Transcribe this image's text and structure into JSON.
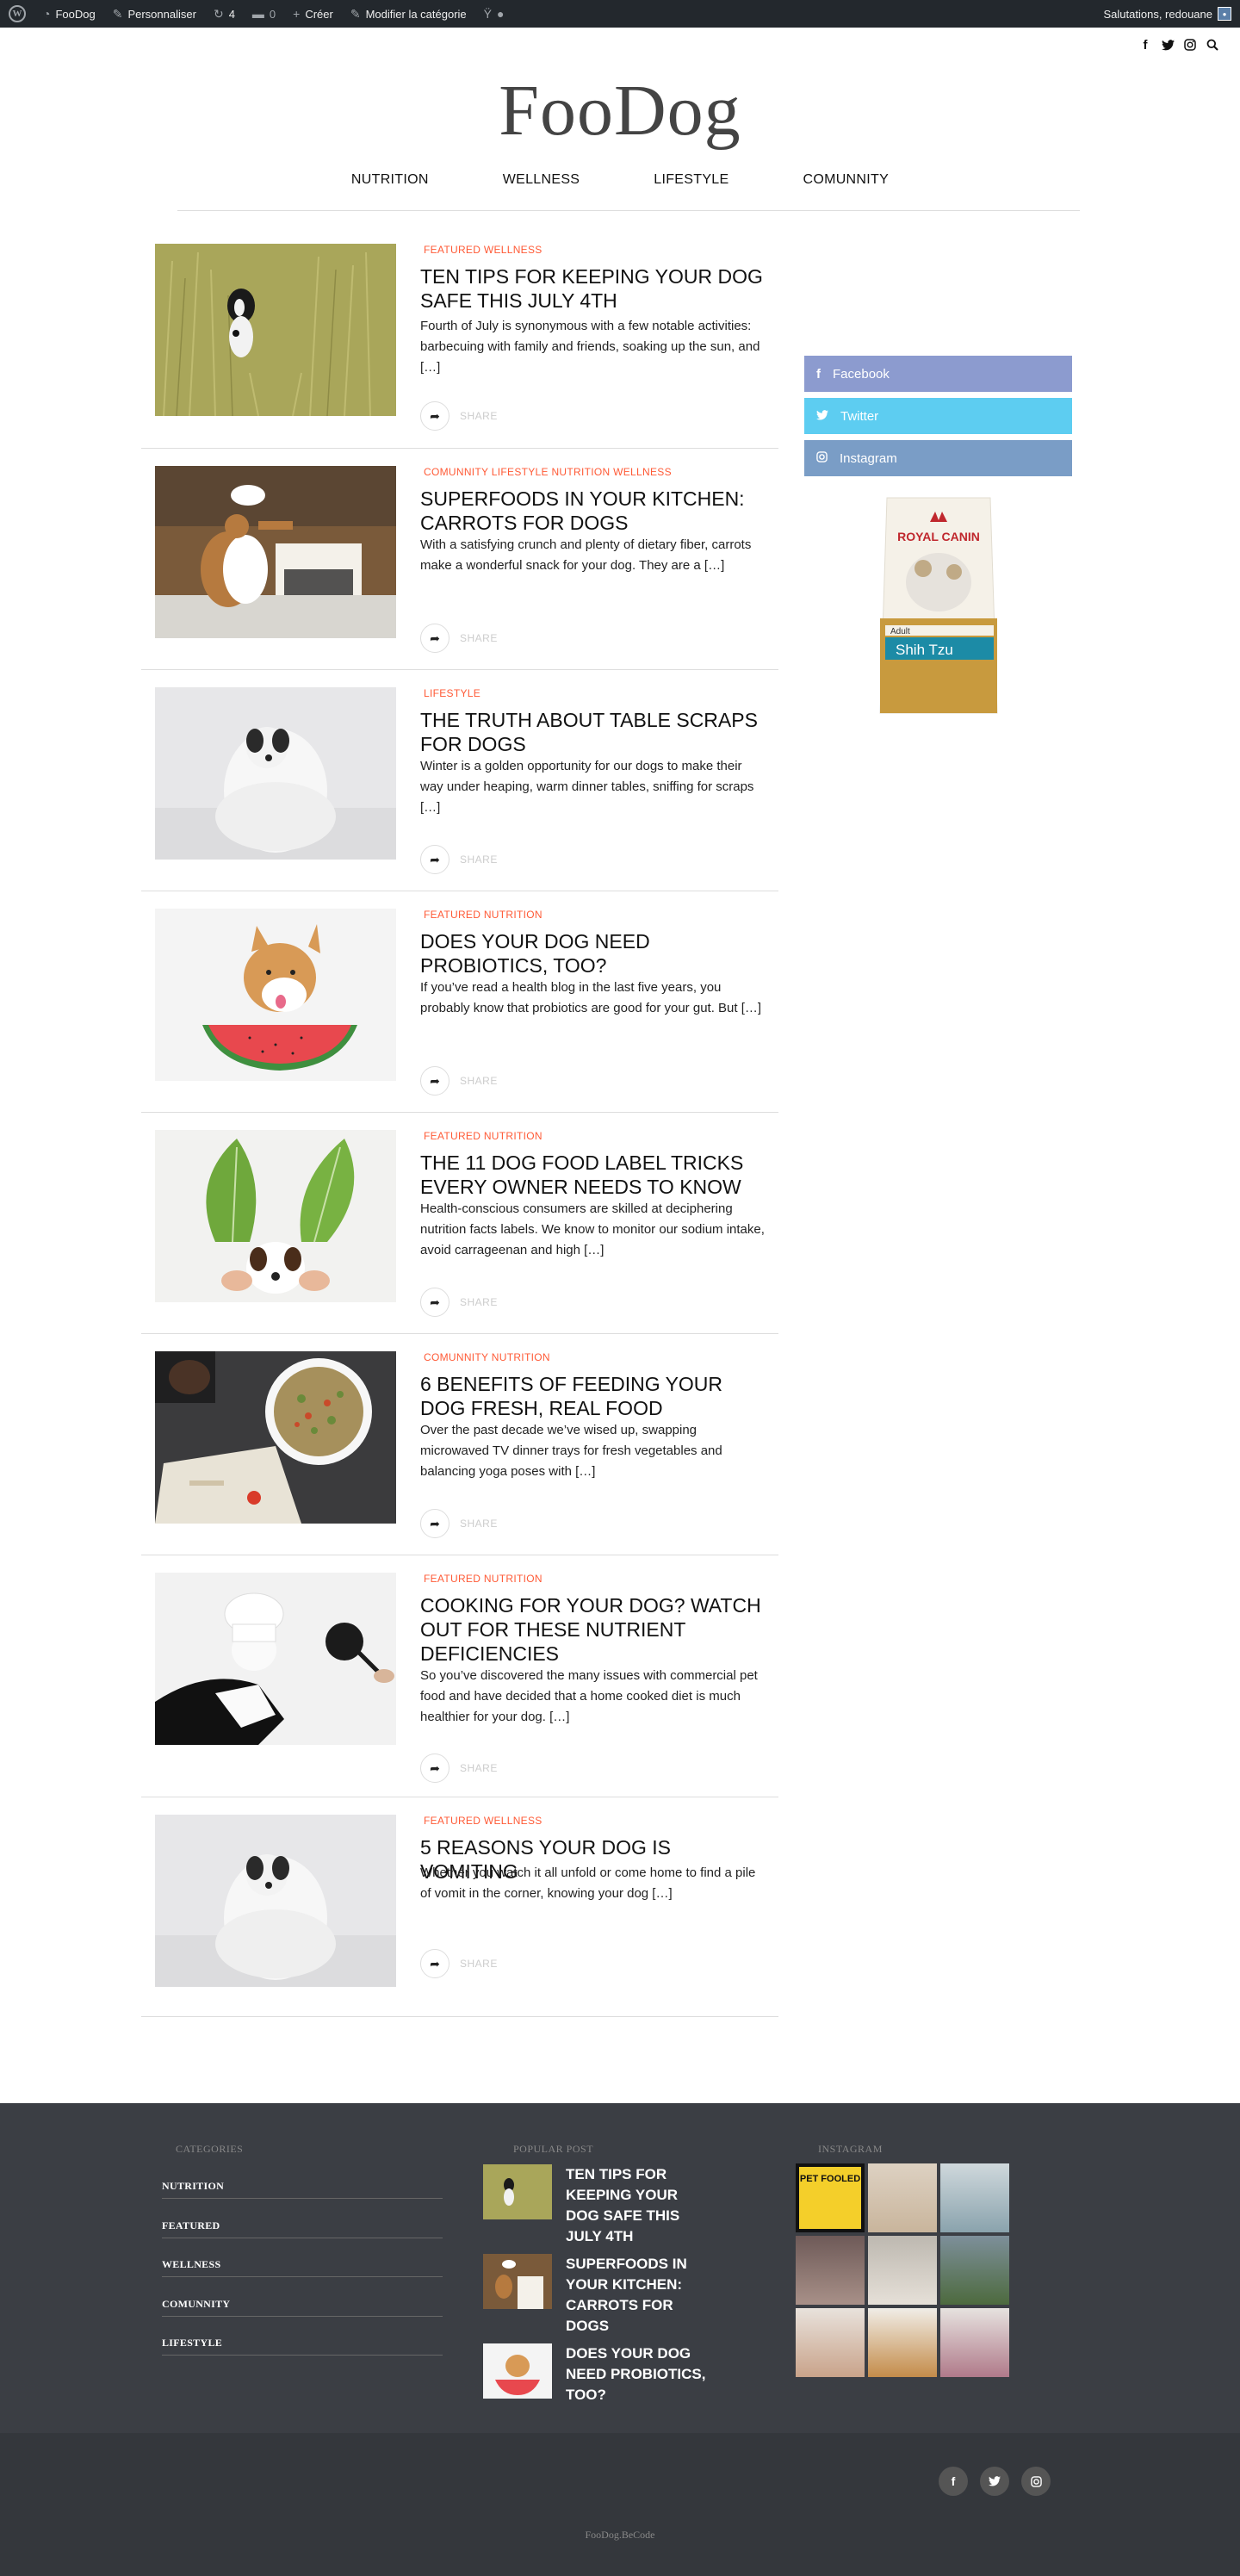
{
  "admin_bar": {
    "site_name": "FooDog",
    "customize": "Personnaliser",
    "updates_count": "4",
    "comments_count": "0",
    "new": "Créer",
    "edit_category": "Modifier la catégorie",
    "greeting": "Salutations, redouane"
  },
  "site": {
    "logo": "FooDog"
  },
  "nav": [
    "NUTRITION",
    "WELLNESS",
    "LIFESTYLE",
    "COMUNNITY"
  ],
  "share_label": "SHARE",
  "posts": [
    {
      "cats": "FEATURED WELLNESS",
      "title": "TEN TIPS FOR KEEPING YOUR DOG SAFE THIS JULY 4TH",
      "excerpt": "Fourth of July is synonymous with a few notable activities: barbecuing with family and friends, soaking up the sun, and […]"
    },
    {
      "cats": "COMUNNITY LIFESTYLE NUTRITION WELLNESS",
      "title": "SUPERFOODS IN YOUR KITCHEN: CARROTS FOR DOGS",
      "excerpt": "With a satisfying crunch and plenty of dietary fiber, carrots make a wonderful snack for your dog. They are a […]"
    },
    {
      "cats": "LIFESTYLE",
      "title": "THE TRUTH ABOUT TABLE SCRAPS FOR DOGS",
      "excerpt": "Winter is a golden opportunity for our dogs to make their way under heaping, warm dinner tables, sniffing for scraps […]"
    },
    {
      "cats": "FEATURED NUTRITION",
      "title": "DOES YOUR DOG NEED PROBIOTICS, TOO?",
      "excerpt": "If you’ve read a health blog in the last five years, you probably know that probiotics are good for your gut. But […]"
    },
    {
      "cats": "FEATURED NUTRITION",
      "title": "THE 11 DOG FOOD LABEL TRICKS EVERY OWNER NEEDS TO KNOW",
      "excerpt": "Health-conscious consumers are skilled at deciphering nutrition facts labels. We know to monitor our sodium intake, avoid carrageenan and high […]"
    },
    {
      "cats": "COMUNNITY NUTRITION",
      "title": "6 BENEFITS OF FEEDING YOUR DOG FRESH, REAL FOOD",
      "excerpt": "Over the past decade we’ve wised up, swapping microwaved TV dinner trays for fresh vegetables and balancing yoga poses with […]"
    },
    {
      "cats": "FEATURED NUTRITION",
      "title": "COOKING FOR YOUR DOG? WATCH OUT FOR THESE NUTRIENT DEFICIENCIES",
      "excerpt": "So you’ve discovered the many issues with commercial pet food and have decided that a home cooked diet is much healthier for your dog. […]"
    },
    {
      "cats": "FEATURED WELLNESS",
      "title": "5 REASONS YOUR DOG IS VOMITING",
      "excerpt": "Whether you watch it all unfold or come home to find a pile of vomit in the corner, knowing your dog […]"
    }
  ],
  "sidebar": {
    "facebook": "Facebook",
    "twitter": "Twitter",
    "instagram": "Instagram",
    "ad_brand": "ROYAL CANIN",
    "ad_stage": "Adult",
    "ad_breed": "Shih Tzu"
  },
  "footer": {
    "categories_heading": "CATEGORIES",
    "categories": [
      "NUTRITION",
      "FEATURED",
      "WELLNESS",
      "COMUNNITY",
      "LIFESTYLE"
    ],
    "popular_heading": "POPULAR POST",
    "popular": [
      "TEN TIPS FOR KEEPING YOUR DOG SAFE THIS JULY 4TH",
      "SUPERFOODS IN YOUR KITCHEN: CARROTS FOR DOGS",
      "DOES YOUR DOG NEED PROBIOTICS, TOO?"
    ],
    "instagram_heading": "INSTAGRAM",
    "insta_caption": "PET FOOLED",
    "credit": "FooDog.BeCode"
  },
  "colors": {
    "accent": "#ff5a36",
    "footer_bg": "#3b3e44",
    "footer_bottom": "#34373c",
    "facebook": "#8c9bcf",
    "twitter": "#5dcdf1",
    "instagram": "#7a9dc6"
  }
}
